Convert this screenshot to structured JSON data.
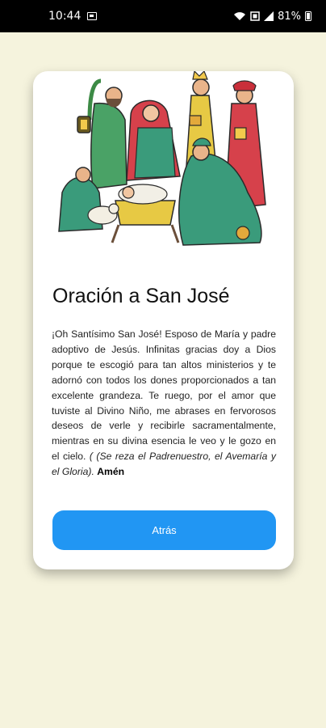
{
  "status": {
    "time": "10:44",
    "battery": "81%"
  },
  "card": {
    "title": "Oración a San José",
    "prayer_text": "¡Oh Santísimo San José! Esposo de María y padre adoptivo de Jesús. Infinitas gracias doy a Dios porque te escogió para tan altos ministerios y te adornó con todos los dones proporcionados a tan excelente grandeza. Te ruego, por el amor que tuviste al Divino Niño, me abrases en fervorosos deseos de verle y recibirle sacramentalmente, mientras en su divina esencia le veo y le gozo en el cielo. ",
    "prayer_note": "( (Se reza el Padrenuestro, el Avemaría y el Gloria).",
    "prayer_end": "Amén",
    "back_button": "Atrás"
  },
  "colors": {
    "background": "#f5f3dd",
    "button": "#2196f3"
  },
  "icons": [
    "image-icon",
    "wifi-icon",
    "data-icon",
    "signal-icon",
    "battery-icon"
  ]
}
